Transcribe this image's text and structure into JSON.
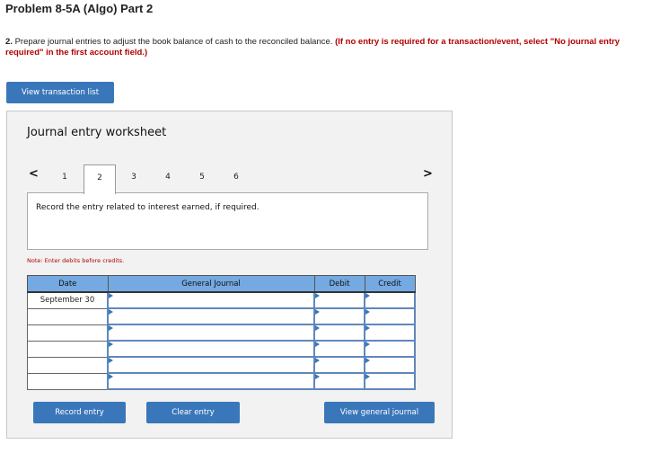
{
  "title": "Problem 8-5A (Algo) Part 2",
  "instructions": {
    "number": "2.",
    "text": " Prepare journal entries to adjust the book balance of cash to the reconciled balance. ",
    "warning": "(If no entry is required for a transaction/event, select \"No journal entry required\" in the first account field.)"
  },
  "buttons": {
    "view_transaction_list": "View transaction list",
    "record_entry": "Record entry",
    "clear_entry": "Clear entry",
    "view_general_journal": "View general journal"
  },
  "worksheet": {
    "title": "Journal entry worksheet",
    "prev_icon": "<",
    "next_icon": ">",
    "tabs": [
      "1",
      "2",
      "3",
      "4",
      "5",
      "6"
    ],
    "active_tab": "2",
    "prompt": "Record the entry related to interest earned, if required.",
    "note": "Note: Enter debits before credits."
  },
  "journal": {
    "headers": [
      "Date",
      "General Journal",
      "Debit",
      "Credit"
    ],
    "rows": [
      {
        "date": "September 30",
        "account": "",
        "debit": "",
        "credit": ""
      },
      {
        "date": "",
        "account": "",
        "debit": "",
        "credit": ""
      },
      {
        "date": "",
        "account": "",
        "debit": "",
        "credit": ""
      },
      {
        "date": "",
        "account": "",
        "debit": "",
        "credit": ""
      },
      {
        "date": "",
        "account": "",
        "debit": "",
        "credit": ""
      },
      {
        "date": "",
        "account": "",
        "debit": "",
        "credit": ""
      }
    ]
  }
}
